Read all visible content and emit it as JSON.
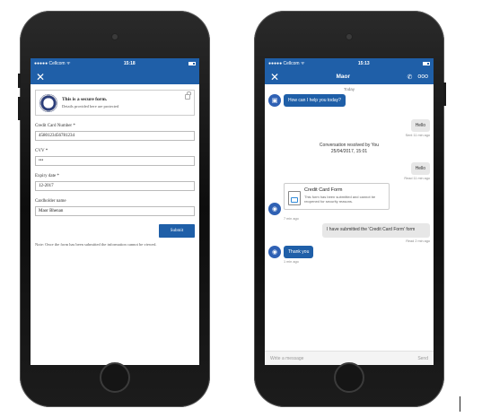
{
  "left_phone": {
    "statusbar": {
      "carrier": "●●●●● Cellcom ᯤ",
      "time": "15:18"
    },
    "secure": {
      "title": "This is a secure form.",
      "subtitle": "Details provided here are protected"
    },
    "fields": [
      {
        "label": "Credit Card Number *",
        "value": "4580123456781234"
      },
      {
        "label": "CVV *",
        "value": "•••"
      },
      {
        "label": "Expiry date *",
        "value": "12-2017"
      },
      {
        "label": "Cardholder name",
        "value": "Maor Bhenan"
      }
    ],
    "submit_label": "Submit",
    "note": "Note: Once the form has been submitted the information cannot be viewed."
  },
  "right_phone": {
    "statusbar": {
      "carrier": "●●●●● Cellcom ᯤ",
      "time": "15:13"
    },
    "title": "Maor",
    "day_label": "Today",
    "agent_greeting": "How can I help you today?",
    "user_hello_1": "Hello",
    "user_hello_1_meta": "Sent  11 min ago",
    "resolved_line1": "Conversation resolved by You",
    "resolved_line2": "25/04/2017, 15:01",
    "user_hello_2": "Hello",
    "user_hello_2_meta": "Read  11 min ago",
    "card": {
      "title": "Credit Card Form",
      "desc": "This form has been submitted and cannot be reopened for security reasons."
    },
    "card_meta": "7 min ago",
    "user_submitted": "I have submitted the 'Credit Card Form' form",
    "user_submitted_meta": "Read  2 min ago",
    "agent_thanks": "Thank you",
    "agent_thanks_meta": "1 min ago",
    "composer_placeholder": "Write a message",
    "send_label": "Send"
  },
  "colors": {
    "accent": "#1f5fa8",
    "bubble_user": "#e7e7e7"
  }
}
